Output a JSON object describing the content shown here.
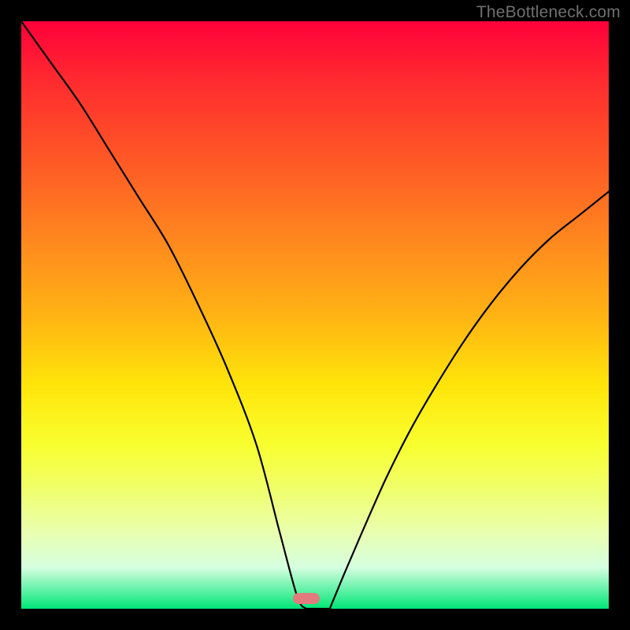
{
  "watermark": "TheBottleneck.com",
  "marker": {
    "x_pct": 48.5,
    "y_pct": 98.2,
    "color": "#e27a7e"
  },
  "chart_data": {
    "type": "line",
    "title": "",
    "xlabel": "",
    "ylabel": "",
    "xlim": [
      0,
      100
    ],
    "ylim": [
      0,
      100
    ],
    "series": [
      {
        "name": "left-curve",
        "x": [
          0,
          5,
          10,
          15,
          20,
          25,
          30,
          35,
          40,
          44,
          47,
          48.5
        ],
        "y": [
          100,
          93,
          86,
          78,
          70,
          62,
          52,
          41,
          28,
          13,
          2,
          0
        ]
      },
      {
        "name": "flat-bottom",
        "x": [
          48.5,
          52.5
        ],
        "y": [
          0,
          0
        ]
      },
      {
        "name": "right-curve",
        "x": [
          52.5,
          55,
          58,
          62,
          66,
          70,
          75,
          80,
          85,
          90,
          95,
          100
        ],
        "y": [
          0,
          6,
          13,
          22,
          30,
          37,
          45,
          52,
          58,
          63,
          67,
          71
        ]
      }
    ],
    "gradient_stops": [
      {
        "pct": 0,
        "color": "#ff003a"
      },
      {
        "pct": 10,
        "color": "#ff2a2f"
      },
      {
        "pct": 25,
        "color": "#ff5d25"
      },
      {
        "pct": 38,
        "color": "#ff8a1e"
      },
      {
        "pct": 50,
        "color": "#ffb313"
      },
      {
        "pct": 62,
        "color": "#ffe50a"
      },
      {
        "pct": 72,
        "color": "#f8ff2e"
      },
      {
        "pct": 80,
        "color": "#f0ff6e"
      },
      {
        "pct": 87,
        "color": "#eaffb0"
      },
      {
        "pct": 93,
        "color": "#d5ffe0"
      },
      {
        "pct": 100,
        "color": "#00e676"
      }
    ]
  }
}
